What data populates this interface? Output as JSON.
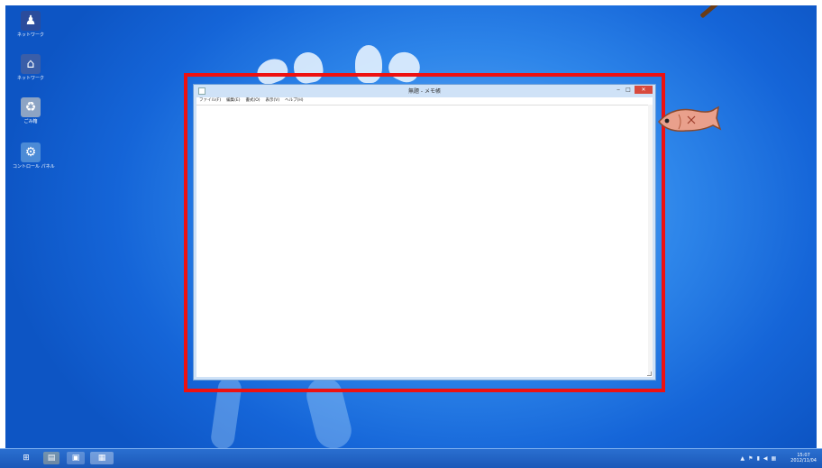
{
  "desktop_icons": [
    {
      "label": "ネットワーク",
      "icon": "user-icon",
      "color": "#2b4c9c"
    },
    {
      "label": "ネットワーク",
      "icon": "network-icon",
      "color": "#3a5ea8"
    },
    {
      "label": "ごみ箱",
      "icon": "recycle-bin-icon",
      "color": "#8da4c4"
    },
    {
      "label": "コントロール パネル",
      "icon": "control-panel-icon",
      "color": "#4c8bd6"
    }
  ],
  "window": {
    "title": "無題 - メモ帳",
    "min_glyph": "‒",
    "max_glyph": "□",
    "close_glyph": "✕",
    "menu": [
      "ファイル(F)",
      "編集(E)",
      "書式(O)",
      "表示(V)",
      "ヘルプ(H)"
    ],
    "text": ""
  },
  "taskbar": {
    "buttons": [
      {
        "name": "start-button",
        "glyph": "⊞"
      },
      {
        "name": "explorer-button",
        "glyph": "▤"
      },
      {
        "name": "app-button",
        "glyph": "▣"
      },
      {
        "name": "notepad-button",
        "glyph": "▦"
      }
    ],
    "tray_icons": [
      "▲",
      "⚑",
      "▮",
      "◀",
      "▦"
    ],
    "time": "15:07",
    "date": "2012/11/04"
  },
  "colors": {
    "highlight": "#ee1111",
    "close_button": "#d84a3e",
    "taskbar": "#1b58b8"
  }
}
